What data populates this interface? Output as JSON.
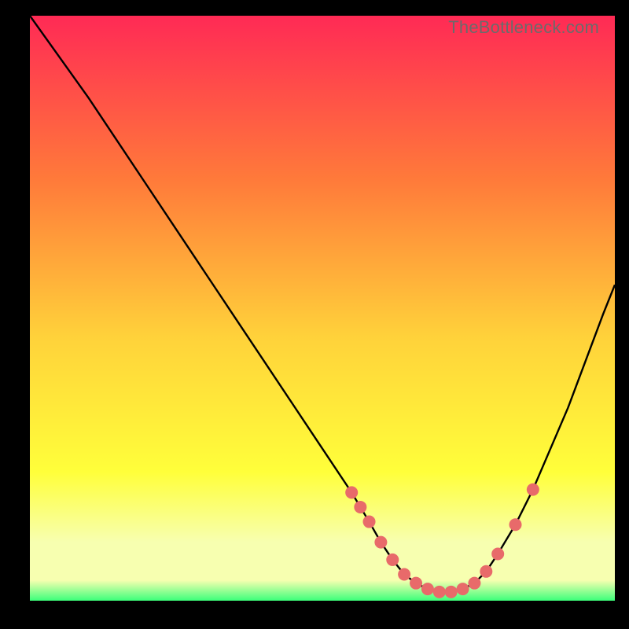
{
  "watermark": "TheBottleneck.com",
  "colors": {
    "gradient_top": "#ff2a55",
    "gradient_mid1": "#ff7a3a",
    "gradient_mid2": "#ffd23a",
    "gradient_yellow": "#ffff3a",
    "gradient_pale": "#f7ffb0",
    "gradient_green": "#3bff7a",
    "dot": "#e86a6a",
    "curve": "#000000",
    "bg": "#000000"
  },
  "chart_data": {
    "type": "line",
    "title": "",
    "xlabel": "",
    "ylabel": "",
    "xlim": [
      0,
      100
    ],
    "ylim": [
      0,
      100
    ],
    "x": [
      0,
      5,
      10,
      15,
      20,
      25,
      30,
      35,
      40,
      45,
      50,
      55,
      58,
      60,
      62,
      64,
      66,
      68,
      70,
      72,
      74,
      76,
      78,
      80,
      83,
      86,
      89,
      92,
      95,
      98,
      100
    ],
    "y": [
      100,
      93,
      86,
      78.5,
      71,
      63.5,
      56,
      48.5,
      41,
      33.5,
      26,
      18.5,
      13.5,
      10,
      7,
      4.5,
      3,
      2,
      1.5,
      1.5,
      2,
      3,
      5,
      8,
      13,
      19,
      26,
      33,
      41,
      49,
      54
    ],
    "markers": {
      "x": [
        55,
        56.5,
        58,
        60,
        62,
        64,
        66,
        68,
        70,
        72,
        74,
        76,
        78,
        80,
        83,
        86
      ],
      "y": [
        18.5,
        16,
        13.5,
        10,
        7,
        4.5,
        3,
        2,
        1.5,
        1.5,
        2,
        3,
        5,
        8,
        13,
        19
      ]
    },
    "legend": []
  }
}
